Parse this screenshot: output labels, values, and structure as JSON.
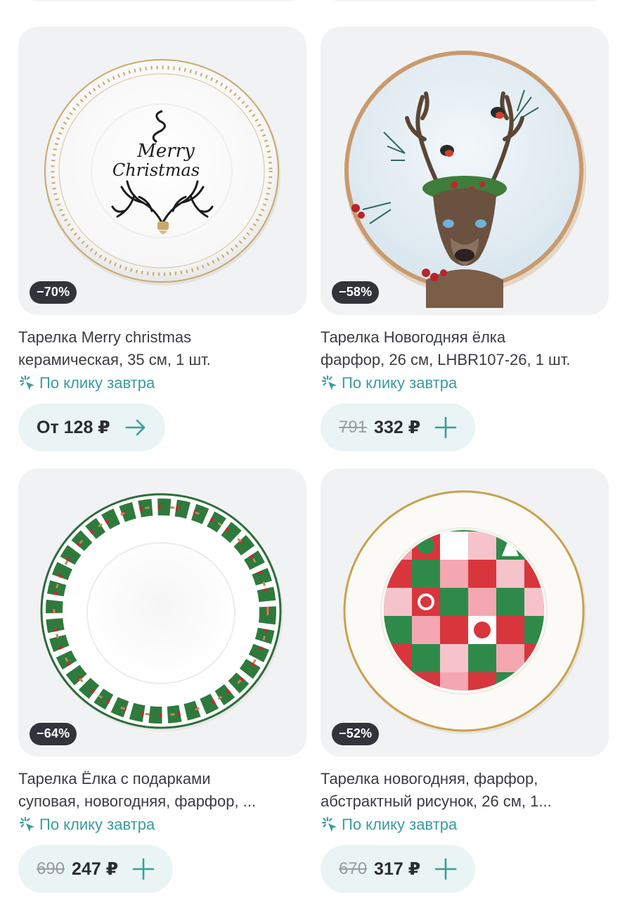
{
  "products": [
    {
      "discount": "−70%",
      "title_line1": "Тарелка Merry christmas",
      "title_line2": "керамическая, 35 см, 1 шт.",
      "delivery": "По клику завтра",
      "old_price": "",
      "price": "От 128 ₽",
      "action_icon": "arrow-right-icon",
      "plate_text_1": "Merry",
      "plate_text_2": "Christmas"
    },
    {
      "discount": "−58%",
      "title_line1": "Тарелка Новогодняя ёлка",
      "title_line2": "фарфор, 26 см, LHBR107-26, 1 шт.",
      "delivery": "По клику завтра",
      "old_price": "791",
      "price": "332 ₽",
      "action_icon": "plus-icon"
    },
    {
      "discount": "−64%",
      "title_line1": "Тарелка Ёлка с подарками",
      "title_line2": "суповая, новогодняя, фарфор, ...",
      "delivery": "По клику завтра",
      "old_price": "690",
      "price": "247 ₽",
      "action_icon": "plus-icon"
    },
    {
      "discount": "−52%",
      "title_line1": "Тарелка новогодняя, фарфор,",
      "title_line2": "абстрактный рисунок, 26 см, 1...",
      "delivery": "По клику завтра",
      "old_price": "670",
      "price": "317 ₽",
      "action_icon": "plus-icon"
    }
  ],
  "colors": {
    "accent": "#3a9c9c",
    "price_button_bg": "#eaf4f5",
    "badge_bg": "#31343a",
    "card_bg": "#f1f2f4"
  }
}
